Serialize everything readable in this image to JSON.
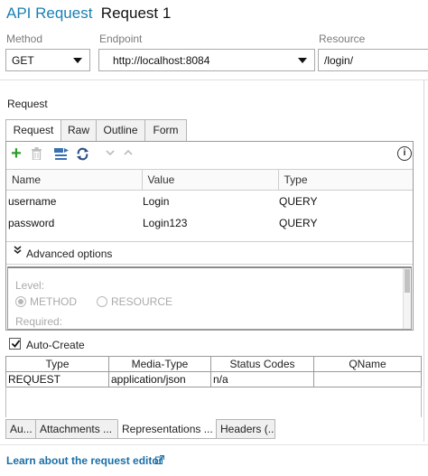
{
  "header": {
    "app_title": "API Request",
    "request_name": "Request 1"
  },
  "method": {
    "label": "Method",
    "value": "GET"
  },
  "endpoint": {
    "label": "Endpoint",
    "value": "http://localhost:8084"
  },
  "resource": {
    "label": "Resource",
    "value": "/login/"
  },
  "request_section": {
    "label": "Request"
  },
  "tabs": [
    {
      "label": "Request",
      "active": true
    },
    {
      "label": "Raw",
      "active": false
    },
    {
      "label": "Outline",
      "active": false
    },
    {
      "label": "Form",
      "active": false
    }
  ],
  "toolbar": {
    "add_icon": "plus-icon",
    "delete_icon": "trash-icon",
    "url_icon": "url-params-icon",
    "sync_icon": "sync-icon",
    "move_down_icon": "chevron-down-icon",
    "move_up_icon": "chevron-up-icon",
    "info_icon": "info-icon",
    "add_glyph": "+",
    "info_glyph": "i"
  },
  "params": {
    "columns": [
      "Name",
      "Value",
      "Type"
    ],
    "rows": [
      {
        "name": "username",
        "value": "Login",
        "type": "QUERY"
      },
      {
        "name": "password",
        "value": "Login123",
        "type": "QUERY"
      }
    ]
  },
  "advanced": {
    "label": "Advanced options",
    "level_label": "Level:",
    "options": [
      "METHOD",
      "RESOURCE"
    ],
    "selected": "METHOD",
    "required_label": "Required:"
  },
  "auto_create": {
    "label": "Auto-Create",
    "checked": true
  },
  "representations": {
    "columns": [
      "Type",
      "Media-Type",
      "Status Codes",
      "QName"
    ],
    "rows": [
      {
        "type": "REQUEST",
        "media_type": "application/json",
        "status_codes": "n/a",
        "qname": ""
      }
    ]
  },
  "bottom_tabs": [
    {
      "label": "Au...",
      "active": false
    },
    {
      "label": "Attachments ...",
      "active": false
    },
    {
      "label": "Representations ...",
      "active": true
    },
    {
      "label": "Headers (...",
      "active": false
    }
  ],
  "footer": {
    "link_text": "Learn about the request editor",
    "link_icon": "external-link-icon"
  },
  "colors": {
    "accent": "#1a7fb4",
    "link": "#1a6fa8",
    "add_green": "#2e9b2e"
  }
}
